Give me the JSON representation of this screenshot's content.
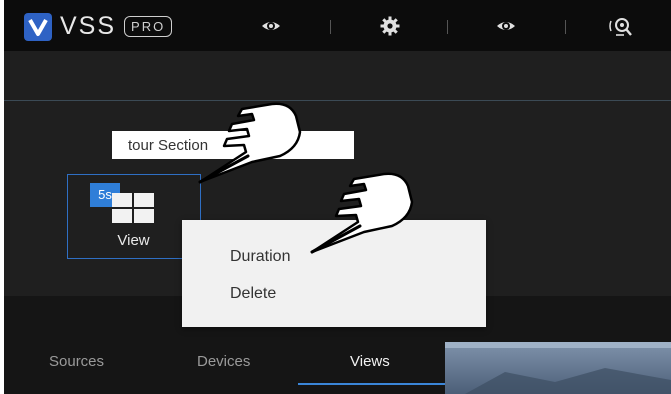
{
  "app": {
    "logo_text": "VSS",
    "badge_text": "PRO"
  },
  "topbar": {
    "icons": [
      "eye-icon",
      "gear-icon",
      "eye-icon",
      "webcam-search-icon"
    ]
  },
  "editor": {
    "tour_input_value": "tour Section",
    "tile": {
      "duration": "5s",
      "label": "View"
    }
  },
  "context_menu": {
    "items": [
      "Duration",
      "Delete"
    ]
  },
  "tabs": [
    {
      "label": "Sources",
      "active": false
    },
    {
      "label": "Devices",
      "active": false
    },
    {
      "label": "Views",
      "active": true
    }
  ],
  "colors": {
    "accent": "#2f7ed8",
    "topbar_bg": "#0c0c0c",
    "panel_bg": "#1f1f1f",
    "menu_bg": "#f1f1f1"
  }
}
